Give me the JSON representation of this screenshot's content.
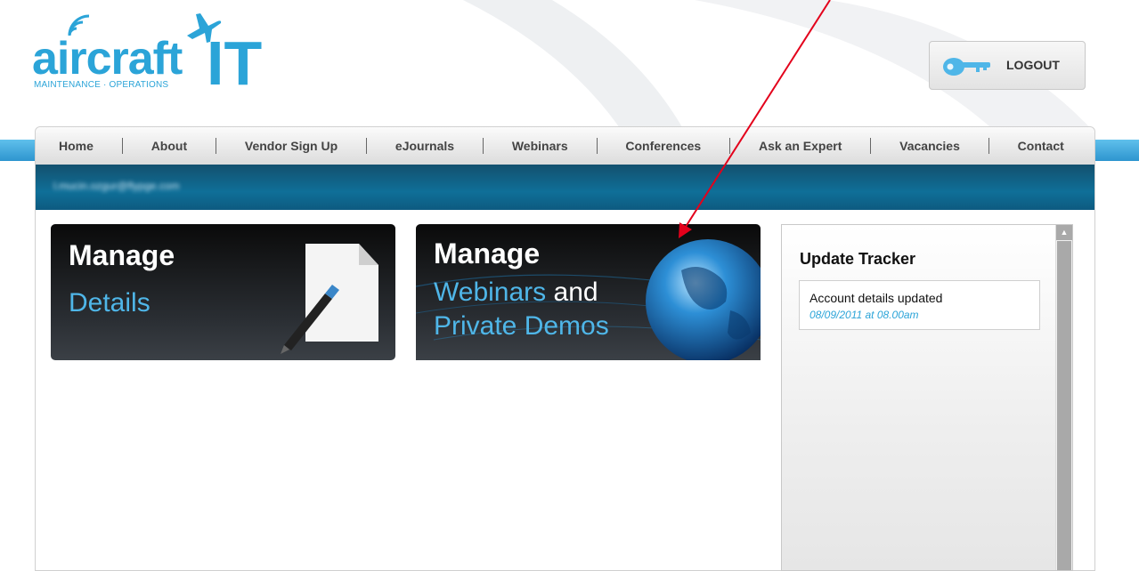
{
  "logo": {
    "word": "aircraft",
    "it": "IT",
    "tagline": "MAINTENANCE · OPERATIONS",
    "color": "#2ba4d8"
  },
  "header": {
    "logout_label": "LOGOUT",
    "logout_icon": "key-icon"
  },
  "nav": {
    "items": [
      {
        "label": "Home"
      },
      {
        "label": "About"
      },
      {
        "label": "Vendor Sign Up"
      },
      {
        "label": "eJournals"
      },
      {
        "label": "Webinars"
      },
      {
        "label": "Conferences"
      },
      {
        "label": "Ask an Expert"
      },
      {
        "label": "Vacancies"
      },
      {
        "label": "Contact"
      }
    ]
  },
  "user": {
    "email": "l.mucin.ozgur@flypge.com"
  },
  "tiles": {
    "details": {
      "title": "Manage",
      "subtitle": "Details",
      "icon": "pencil-document-icon"
    },
    "webinars": {
      "title": "Manage",
      "subtitle_blue": "Webinars",
      "subtitle_and": " and",
      "subtitle_line2": "Private Demos",
      "icon": "globe-icon"
    }
  },
  "tracker": {
    "title": "Update Tracker",
    "items": [
      {
        "text": "Account details updated",
        "date": "08/09/2011 at 08.00am"
      }
    ]
  },
  "colors": {
    "accent": "#2ba4d8",
    "userbar": "#0f6f98",
    "annotation_arrow": "#e3001b"
  }
}
